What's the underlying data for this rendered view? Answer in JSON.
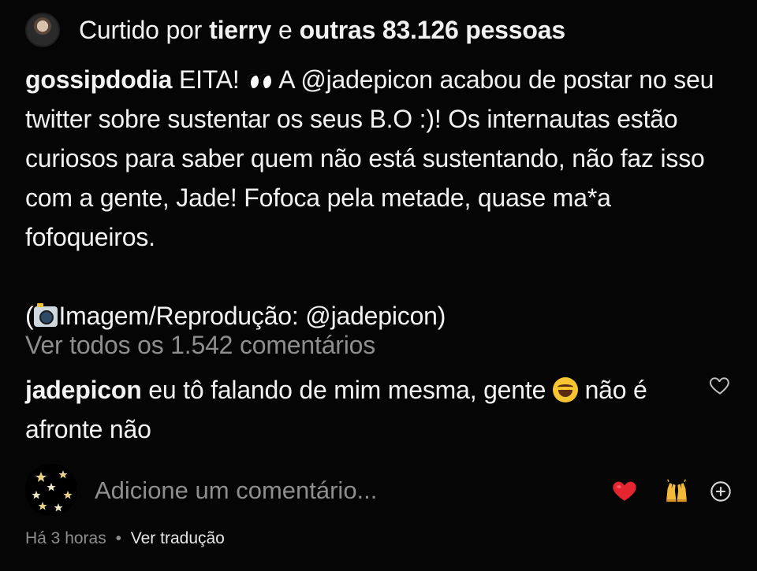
{
  "likes": {
    "prefix": "Curtido por",
    "user": "tierry",
    "connector": "e",
    "others": "outras 83.126 pessoas"
  },
  "caption": {
    "username": "gossipdodia",
    "text_before_emoji": "EITA!",
    "emoji": "eyes-icon",
    "text_rest": "A @jadepicon acabou de postar no seu twitter sobre sustentar os seus B.O :)! Os internautas estão curiosos para saber quem não está sustentando, não faz isso com a gente, Jade! Fofoca pela metade, quase ma*a fofoqueiros.",
    "credit_open": "(",
    "credit_icon": "camera-icon",
    "credit_text": "Imagem/Reprodução: @jadepicon)"
  },
  "view_comments": "Ver todos os 1.542 comentários",
  "reply": {
    "username": "jadepicon",
    "text_before_emoji": "eu tô falando de mim mesma, gente",
    "emoji": "laugh-icon",
    "text_after_emoji": "não é afronte não"
  },
  "add_comment": {
    "placeholder": "Adicione um comentário...",
    "quick_reactions": [
      "heart-icon",
      "raising-hands-icon",
      "add-reaction-icon"
    ]
  },
  "meta": {
    "time": "Há 3 horas",
    "separator": "•",
    "translate": "Ver tradução"
  },
  "colors": {
    "background": "#050505",
    "text": "#f2f2f2",
    "secondary_text": "#8e8e8e",
    "heart_red": "#e5252f",
    "emoji_yellow": "#f7c531"
  }
}
